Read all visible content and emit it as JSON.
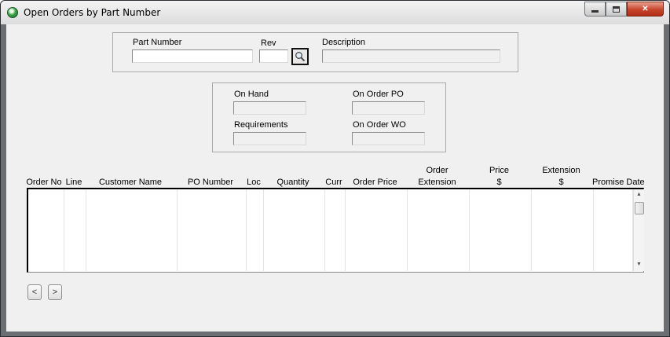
{
  "window": {
    "title": "Open Orders by Part Number",
    "min_symbol": "",
    "max_symbol": "",
    "close_symbol": "✕"
  },
  "part": {
    "part_number_label": "Part Number",
    "part_number_value": "",
    "rev_label": "Rev",
    "rev_value": "",
    "description_label": "Description",
    "description_value": ""
  },
  "stock": {
    "on_hand_label": "On Hand",
    "on_hand_value": "",
    "on_order_po_label": "On Order PO",
    "on_order_po_value": "",
    "requirements_label": "Requirements",
    "requirements_value": "",
    "on_order_wo_label": "On Order WO",
    "on_order_wo_value": ""
  },
  "table": {
    "columns": [
      "Order No",
      "Line",
      "Customer Name",
      "PO Number",
      "Loc",
      "Quantity",
      "Curr",
      "Order Price",
      "Order Extension",
      "Price $",
      "Extension $",
      "Promise Date"
    ],
    "column_lines": [
      [
        "Order No"
      ],
      [
        "Line"
      ],
      [
        "Customer Name"
      ],
      [
        "PO Number"
      ],
      [
        "Loc"
      ],
      [
        "Quantity"
      ],
      [
        "Curr"
      ],
      [
        "Order Price"
      ],
      [
        "Order",
        "Extension"
      ],
      [
        "Price",
        "$"
      ],
      [
        "Extension",
        "$"
      ],
      [
        "Promise Date"
      ]
    ],
    "rows": []
  },
  "nav": {
    "prev_label": "<",
    "next_label": ">"
  },
  "colors": {
    "window_background": "#f0f0f0",
    "frame": "#6b6e73",
    "close_button": "#c7432a"
  },
  "icons": {
    "app": "globe-icon",
    "search": "magnifier-icon"
  }
}
